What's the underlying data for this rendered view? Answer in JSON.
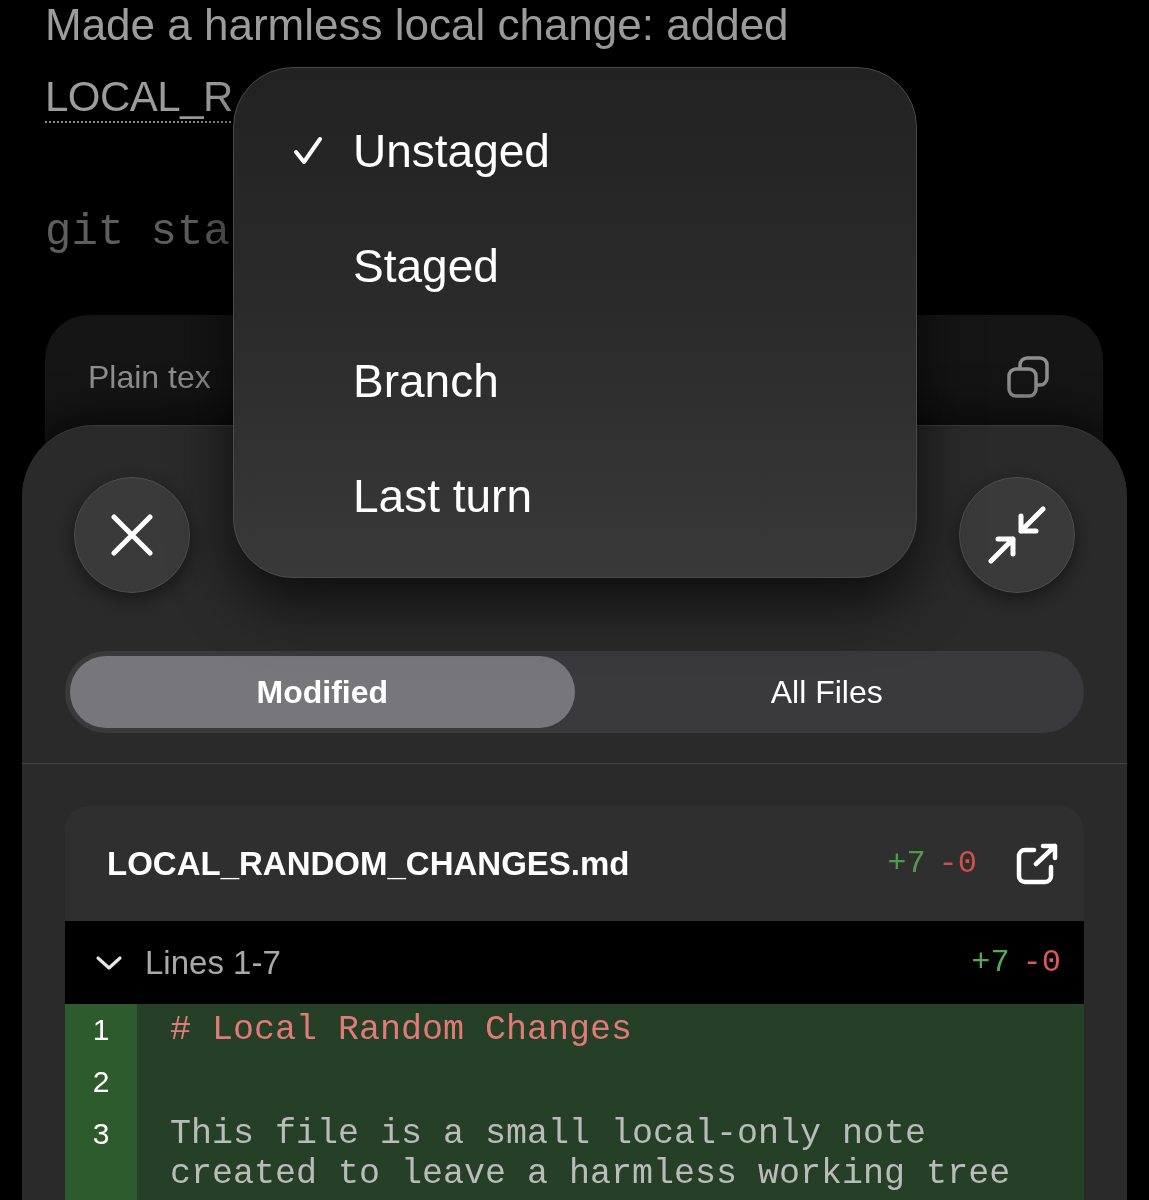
{
  "chat": {
    "message": "Made a harmless local change: added",
    "file_link": "LOCAL_R",
    "command": "git sta"
  },
  "code_block": {
    "language": "Plain tex"
  },
  "menu": {
    "items": [
      {
        "label": "Unstaged",
        "selected": true
      },
      {
        "label": "Staged",
        "selected": false
      },
      {
        "label": "Branch",
        "selected": false
      },
      {
        "label": "Last turn",
        "selected": false
      }
    ]
  },
  "sheet": {
    "tabs": [
      {
        "label": "Modified",
        "selected": true
      },
      {
        "label": "All Files",
        "selected": false
      }
    ],
    "file": {
      "name": "LOCAL_RANDOM_CHANGES.md",
      "additions": "+7",
      "deletions": "-0",
      "hunk": {
        "title": "Lines 1-7",
        "expanded": true,
        "additions": "+7",
        "deletions": "-0",
        "lines": [
          {
            "number": "1",
            "added": true,
            "kind": "heading",
            "text": "# Local Random Changes"
          },
          {
            "number": "2",
            "added": true,
            "kind": "blank"
          },
          {
            "number": "3",
            "added": true,
            "kind": "text",
            "text": "This file is a small local-only note created to leave a harmless working tree"
          }
        ]
      }
    }
  }
}
